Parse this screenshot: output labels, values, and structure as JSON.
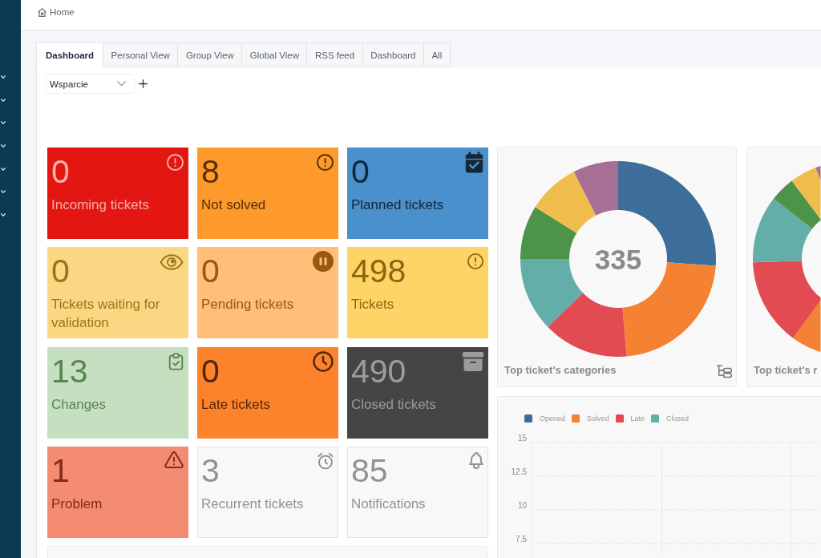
{
  "sidebar": {
    "items": [
      {
        "expanded": false
      },
      {
        "expanded": false
      },
      {
        "expanded": false
      },
      {
        "expanded": false
      },
      {
        "expanded": false
      },
      {
        "expanded": false
      },
      {
        "expanded": false
      }
    ]
  },
  "breadcrumb": [
    {
      "label": "Home"
    }
  ],
  "tabs": [
    {
      "label": "Dashboard",
      "selected": true
    },
    {
      "label": "Personal View",
      "selected": false
    },
    {
      "label": "Group View",
      "selected": false
    },
    {
      "label": "Global View",
      "selected": false
    },
    {
      "label": "RSS feed",
      "selected": false
    },
    {
      "label": "Dashboard",
      "selected": false
    },
    {
      "label": "All",
      "selected": false
    }
  ],
  "dashboard_select": {
    "value": "Wsparcie"
  },
  "cards": [
    {
      "value": "0",
      "label": "Incoming tickets",
      "color": "#e31611"
    },
    {
      "value": "8",
      "label": "Not solved",
      "color": "#fe992b"
    },
    {
      "value": "0",
      "label": "Planned tickets",
      "color": "#4a90cd"
    },
    {
      "value": "0",
      "label": "Tickets waiting for validation",
      "color": "#fbd784"
    },
    {
      "value": "0",
      "label": "Pending tickets",
      "color": "#ffbf78"
    },
    {
      "value": "498",
      "label": "Tickets",
      "color": "#ffd466"
    },
    {
      "value": "13",
      "label": "Changes",
      "color": "#c5dfc0"
    },
    {
      "value": "0",
      "label": "Late tickets",
      "color": "#fd822c"
    },
    {
      "value": "490",
      "label": "Closed tickets",
      "color": "#454545"
    },
    {
      "value": "1",
      "label": "Problem",
      "color": "#f48b73"
    },
    {
      "value": "3",
      "label": "Recurrent tickets",
      "color": "#f8f8f8"
    },
    {
      "value": "85",
      "label": "Notifications",
      "color": "#f8f8f8"
    }
  ],
  "donut_widgets": [
    {
      "total": "335",
      "title": "Top ticket's categories"
    },
    {
      "title": "Top ticket's r"
    }
  ],
  "line_widget": {
    "chart_data": {
      "type": "line",
      "series": [
        {
          "name": "Opened",
          "color": "#3d6e99"
        },
        {
          "name": "Solved",
          "color": "#f58232"
        },
        {
          "name": "Late",
          "color": "#e14b51"
        },
        {
          "name": "Closed",
          "color": "#64aea9"
        }
      ],
      "ylim": [
        7.5,
        15
      ],
      "yticks": [
        7.5,
        10,
        12.5,
        15
      ]
    }
  }
}
